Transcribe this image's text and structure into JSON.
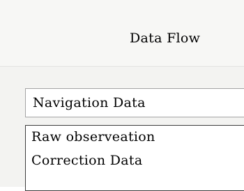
{
  "header": {
    "title": "Data Flow"
  },
  "data_type_select": {
    "selected_value": "Navigation Data"
  },
  "data_type_options": {
    "items": [
      {
        "label": "Raw observeation"
      },
      {
        "label": "Correction Data"
      }
    ]
  }
}
